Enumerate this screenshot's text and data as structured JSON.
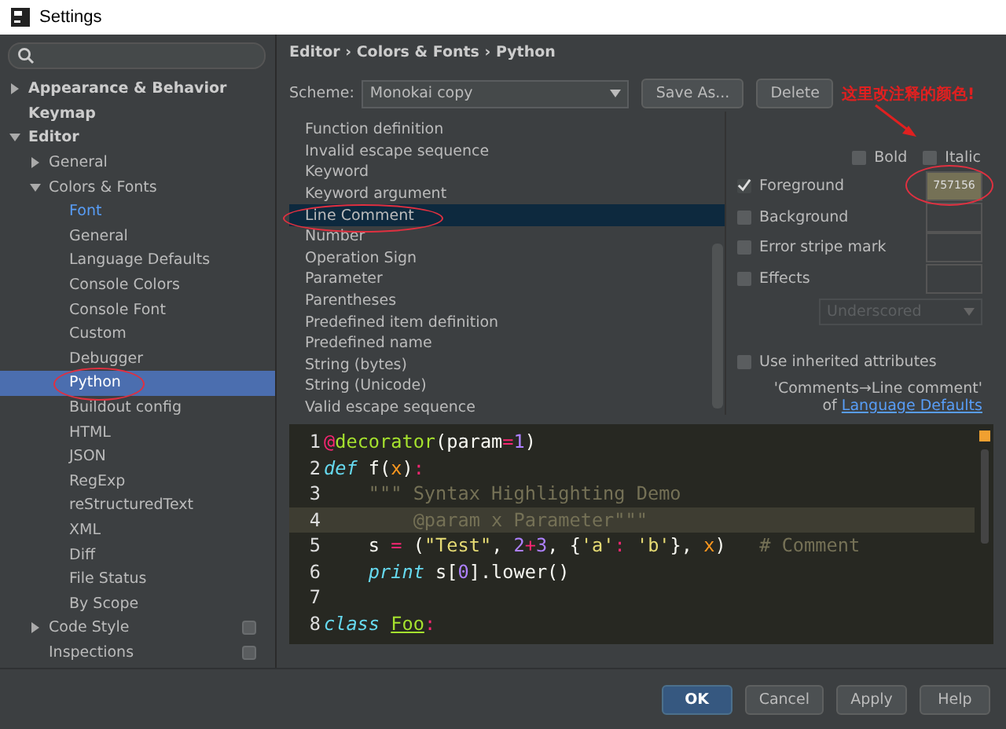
{
  "window": {
    "title": "Settings"
  },
  "sidebar": {
    "items": [
      {
        "label": "Appearance & Behavior",
        "bold": true,
        "expanded": false
      },
      {
        "label": "Keymap",
        "bold": true
      },
      {
        "label": "Editor",
        "bold": true,
        "expanded": true,
        "children": [
          {
            "label": "General",
            "expanded": false
          },
          {
            "label": "Colors & Fonts",
            "expanded": true,
            "children": [
              {
                "label": "Font",
                "modified": true,
                "selected": false
              },
              {
                "label": "General",
                "selected": false
              },
              {
                "label": "Language Defaults",
                "selected": false
              },
              {
                "label": "Console Colors",
                "selected": false
              },
              {
                "label": "Console Font",
                "selected": false
              },
              {
                "label": "Custom",
                "selected": false
              },
              {
                "label": "Debugger",
                "selected": false
              },
              {
                "label": "Python",
                "selected": true,
                "circled": true
              },
              {
                "label": "Buildout config",
                "selected": false
              },
              {
                "label": "HTML",
                "selected": false
              },
              {
                "label": "JSON",
                "selected": false
              },
              {
                "label": "RegExp",
                "selected": false
              },
              {
                "label": "reStructuredText",
                "selected": false
              },
              {
                "label": "XML",
                "selected": false
              },
              {
                "label": "Diff",
                "selected": false
              },
              {
                "label": "File Status",
                "selected": false
              },
              {
                "label": "By Scope",
                "selected": false
              }
            ]
          },
          {
            "label": "Code Style",
            "expanded": false,
            "project": true
          },
          {
            "label": "Inspections",
            "project": true
          }
        ]
      }
    ]
  },
  "breadcrumb": "Editor › Colors & Fonts › Python",
  "scheme": {
    "label": "Scheme:",
    "value": "Monokai copy",
    "buttons": [
      "Save As...",
      "Delete"
    ]
  },
  "annotation": {
    "text": "这里改注释的颜色!"
  },
  "attributes": [
    {
      "label": "Function definition",
      "selected": false
    },
    {
      "label": "Invalid escape sequence",
      "selected": false
    },
    {
      "label": "Keyword",
      "selected": false
    },
    {
      "label": "Keyword argument",
      "selected": false
    },
    {
      "label": "Line Comment",
      "selected": true,
      "circled": true
    },
    {
      "label": "Number",
      "selected": false
    },
    {
      "label": "Operation Sign",
      "selected": false
    },
    {
      "label": "Parameter",
      "selected": false
    },
    {
      "label": "Parentheses",
      "selected": false
    },
    {
      "label": "Predefined item definition",
      "selected": false
    },
    {
      "label": "Predefined name",
      "selected": false
    },
    {
      "label": "String (bytes)",
      "selected": false
    },
    {
      "label": "String (Unicode)",
      "selected": false
    },
    {
      "label": "Valid escape sequence",
      "selected": false
    }
  ],
  "styles": [
    {
      "label": "Bold",
      "checked": false
    },
    {
      "label": "Italic",
      "checked": false
    }
  ],
  "colors": [
    {
      "label": "Foreground",
      "checked": true,
      "value": "757156",
      "color": "#757156",
      "circled": true
    },
    {
      "label": "Background",
      "checked": false
    },
    {
      "label": "Error stripe mark",
      "checked": false
    },
    {
      "label": "Effects",
      "checked": false
    }
  ],
  "effect_type": {
    "value": "Underscored",
    "disabled": true
  },
  "inherit": {
    "label": "Use inherited attributes",
    "checked": false,
    "source": "'Comments→Line comment'",
    "of": "of",
    "link": "Language Defaults"
  },
  "code": [
    {
      "n": "1",
      "highlighted": false,
      "tokens": [
        {
          "kind": "deco",
          "t": "@"
        },
        {
          "kind": "fn",
          "t": "decorator"
        },
        {
          "kind": "plain",
          "t": "(param"
        },
        {
          "kind": "op",
          "t": "="
        },
        {
          "kind": "num",
          "t": "1"
        },
        {
          "kind": "plain",
          "t": ")"
        }
      ]
    },
    {
      "n": "2",
      "highlighted": false,
      "tokens": [
        {
          "kind": "kw",
          "t": "def"
        },
        {
          "kind": "plain",
          "t": " f("
        },
        {
          "kind": "param",
          "t": "x"
        },
        {
          "kind": "plain",
          "t": ")"
        },
        {
          "kind": "op",
          "t": ":"
        }
      ]
    },
    {
      "n": "3",
      "highlighted": false,
      "tokens": [
        {
          "kind": "doc",
          "t": "    \"\"\" Syntax Highlighting Demo"
        }
      ]
    },
    {
      "n": "4",
      "highlighted": true,
      "tokens": [
        {
          "kind": "doc",
          "t": "        @param x Parameter\"\"\""
        }
      ]
    },
    {
      "n": "5",
      "highlighted": false,
      "tokens": [
        {
          "kind": "plain",
          "t": "    s "
        },
        {
          "kind": "op",
          "t": "="
        },
        {
          "kind": "plain",
          "t": " ("
        },
        {
          "kind": "str",
          "t": "\"Test\""
        },
        {
          "kind": "plain",
          "t": ", "
        },
        {
          "kind": "num",
          "t": "2"
        },
        {
          "kind": "op",
          "t": "+"
        },
        {
          "kind": "num",
          "t": "3"
        },
        {
          "kind": "plain",
          "t": ", {"
        },
        {
          "kind": "str",
          "t": "'a'"
        },
        {
          "kind": "op",
          "t": ":"
        },
        {
          "kind": "str",
          "t": " 'b'"
        },
        {
          "kind": "plain",
          "t": "}, "
        },
        {
          "kind": "param",
          "t": "x"
        },
        {
          "kind": "plain",
          "t": ")   "
        },
        {
          "kind": "comment",
          "t": "# Comment"
        }
      ]
    },
    {
      "n": "6",
      "highlighted": false,
      "tokens": [
        {
          "kind": "kw",
          "t": "    print"
        },
        {
          "kind": "plain",
          "t": " s["
        },
        {
          "kind": "num",
          "t": "0"
        },
        {
          "kind": "plain",
          "t": "].lower()"
        }
      ]
    },
    {
      "n": "7",
      "highlighted": false
    },
    {
      "n": "8",
      "highlighted": false,
      "tokens": [
        {
          "kind": "kw",
          "t": "class "
        },
        {
          "kind": "cls",
          "t": "Foo"
        },
        {
          "kind": "op",
          "t": ":"
        }
      ]
    }
  ],
  "buttons": [
    {
      "label": "OK",
      "default": true
    },
    {
      "label": "Cancel",
      "default": false
    },
    {
      "label": "Apply",
      "default": false
    },
    {
      "label": "Help",
      "default": false
    }
  ]
}
